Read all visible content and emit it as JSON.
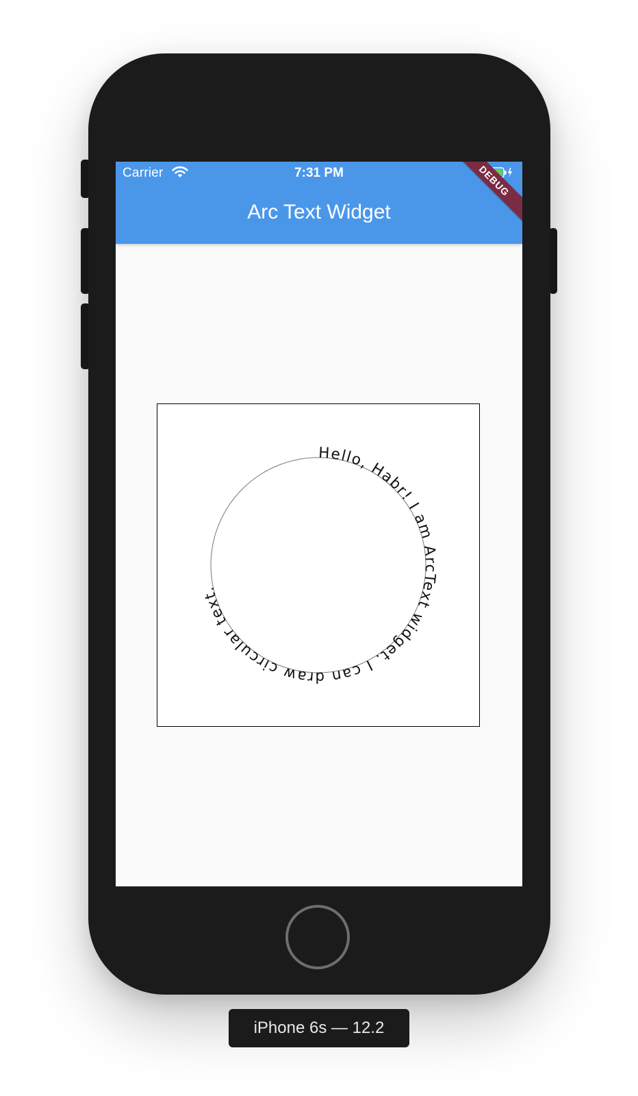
{
  "status_bar": {
    "carrier": "Carrier",
    "time": "7:31 PM",
    "wifi_icon": "wifi-icon",
    "battery_icon": "battery-charging-icon"
  },
  "app_bar": {
    "title": "Arc Text Widget",
    "background_color": "#4a97ea"
  },
  "debug_banner": {
    "label": "DEBUG",
    "color": "#7b2c44"
  },
  "arc_text": {
    "text": "Hello, Habr! I am ArcText widget. I can draw circular text."
  },
  "device_label": {
    "text": "iPhone 6s — 12.2"
  }
}
